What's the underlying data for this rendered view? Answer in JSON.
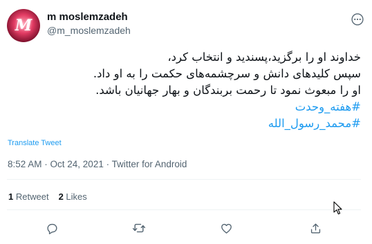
{
  "user": {
    "display_name": "m moslemzadeh",
    "handle": "@m_moslemzadeh",
    "avatar_monogram": "M"
  },
  "tweet": {
    "lines": [
      "خداوند او را برگزید،پسندید و انتخاب کرد،",
      "سپس کلیدهای دانش و سرچشمه‌های حکمت را به او داد.",
      "او را مبعوث نمود تا رحمت بربندگان و بهار جهانیان باشد."
    ],
    "hashtags": [
      "#هفته_وحدت",
      "#محمد_رسول_الله"
    ]
  },
  "translate_label": "Translate Tweet",
  "meta": "8:52 AM · Oct 24, 2021 · Twitter for Android",
  "stats": {
    "retweets_count": "1",
    "retweets_label": "Retweet",
    "likes_count": "2",
    "likes_label": "Likes"
  },
  "icons": {
    "more": "more-icon",
    "reply": "reply-icon",
    "retweet": "retweet-icon",
    "like": "like-icon",
    "share": "share-icon"
  },
  "colors": {
    "accent": "#1d9bf0",
    "secondary_text": "#536471",
    "primary_text": "#0f1419",
    "divider": "#eff3f4"
  }
}
